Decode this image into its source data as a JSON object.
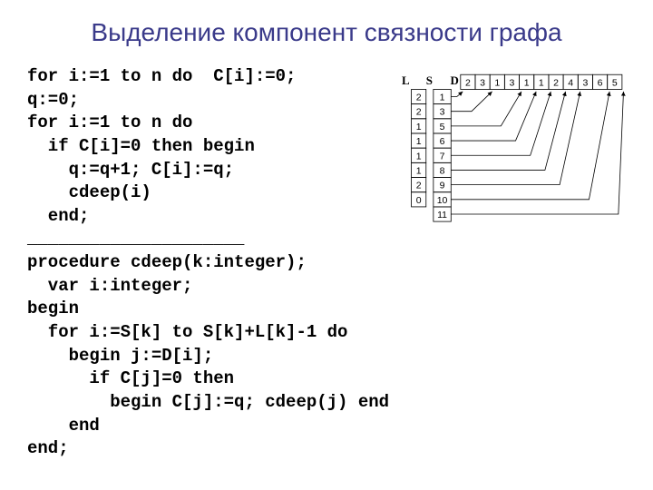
{
  "title": "Выделение компонент связности графа",
  "code": {
    "l1": "for i:=1 to n do  C[i]:=0;",
    "l2": "q:=0;",
    "l3": "for i:=1 to n do",
    "l4": "  if C[i]=0 then begin",
    "l5": "    q:=q+1; C[i]:=q;",
    "l6": "    cdeep(i)",
    "l7": "  end;",
    "l8": "_____________________",
    "l9": "procedure cdeep(k:integer);",
    "l10": "  var i:integer;",
    "l11": "begin",
    "l12": "  for i:=S[k] to S[k]+L[k]-1 do",
    "l13": "    begin j:=D[i];",
    "l14": "      if C[j]=0 then",
    "l15": "        begin C[j]:=q; cdeep(j) end",
    "l16": "    end",
    "l17": "end;"
  },
  "diagram": {
    "labels": {
      "L": "L",
      "S": "S",
      "D": "D"
    },
    "L_col": [
      "2",
      "2",
      "1",
      "1",
      "1",
      "1",
      "2",
      "0"
    ],
    "S_col": [
      "1",
      "3",
      "5",
      "6",
      "7",
      "8",
      "9",
      "10",
      "11"
    ],
    "D_row": [
      "2",
      "3",
      "1",
      "3",
      "1",
      "1",
      "2",
      "4",
      "3",
      "6",
      "5"
    ]
  }
}
